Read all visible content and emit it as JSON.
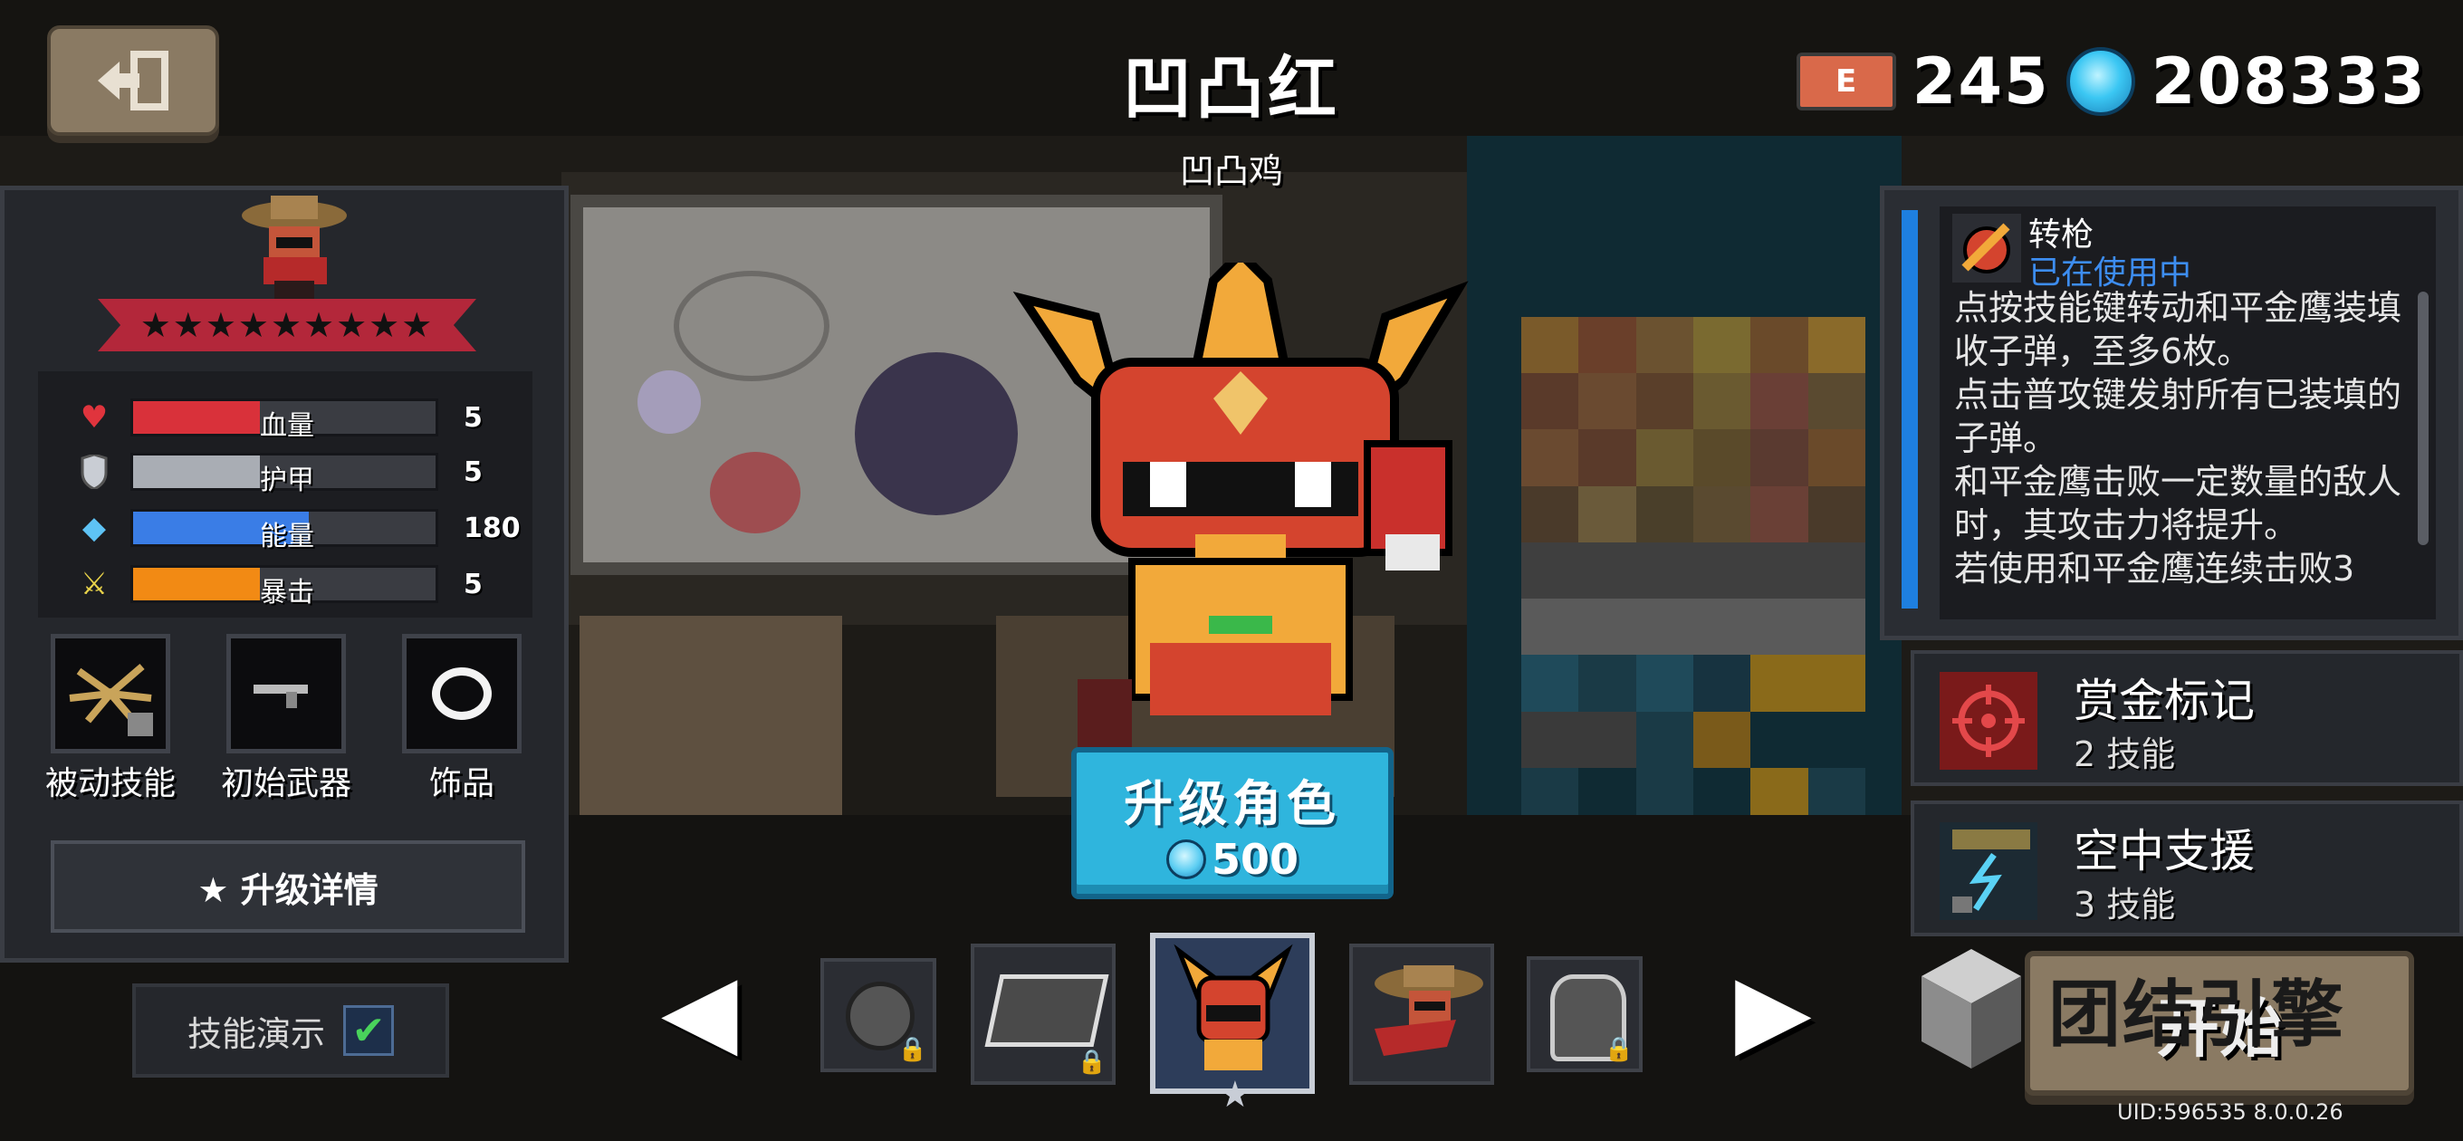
{
  "header": {
    "back_icon": "exit-door-icon",
    "character_name": "凹凸红",
    "character_subtitle": "凹凸鸡",
    "ecard_label": "E",
    "ecard_count": "245",
    "gem_count": "208333"
  },
  "stats_panel": {
    "stars": "★★★★★★★★★",
    "stats": [
      {
        "label": "血量",
        "value": "5",
        "fill": 0.42,
        "color": "#d9313a",
        "icon": "heart-icon"
      },
      {
        "label": "护甲",
        "value": "5",
        "fill": 0.42,
        "color": "#a9adb4",
        "icon": "shield-icon"
      },
      {
        "label": "能量",
        "value": "180",
        "fill": 0.58,
        "color": "#3a7de6",
        "icon": "diamond-icon"
      },
      {
        "label": "暴击",
        "value": "5",
        "fill": 0.42,
        "color": "#f28a14",
        "icon": "crit-weapon-icon"
      }
    ],
    "slots": [
      {
        "label": "被动技能"
      },
      {
        "label": "初始武器"
      },
      {
        "label": "饰品"
      }
    ],
    "upgrade_detail_label": "★ 升级详情",
    "skill_demo_label": "技能演示",
    "skill_demo_checked": "✔"
  },
  "center": {
    "upgrade_label": "升级角色",
    "upgrade_cost": "500"
  },
  "carousel": {
    "left_arrow": "◀",
    "right_arrow": "▶",
    "selected_star": "★"
  },
  "skill_panel": {
    "current_skill": {
      "name": "转枪",
      "status": "已在使用中",
      "description": "点按技能键转动和平金鹰装填收子弹，至多6枚。\n点击普攻键发射所有已装填的子弹。\n和平金鹰击败一定数量的敌人时，其攻击力将提升。\n若使用和平金鹰连续击败3"
    },
    "alt_skills": [
      {
        "name": "赏金标记",
        "sub": "2 技能"
      },
      {
        "name": "空中支援",
        "sub": "3 技能"
      }
    ]
  },
  "start_button": {
    "label": "开始",
    "overlay": "团结引擎"
  },
  "footer": {
    "uid": "UID:596535 8.0.0.26"
  }
}
